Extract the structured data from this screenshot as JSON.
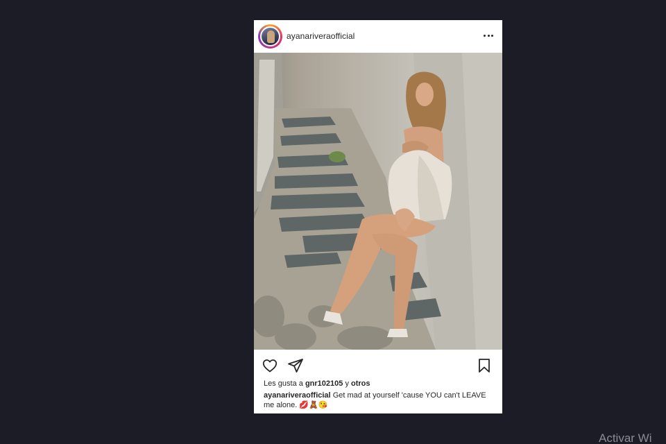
{
  "post": {
    "username": "ayanariveraofficial",
    "likes": {
      "prefix": "Les gusta a",
      "user": "gnr102105",
      "connector": "y",
      "others": "otros"
    },
    "caption": {
      "username": "ayanariveraofficial",
      "text": "Get mad at yourself 'cause YOU can't LEAVE me alone. 💋🧸😘"
    }
  },
  "icons": {
    "more": "more-options-icon",
    "like": "heart-icon",
    "share": "send-icon",
    "save": "bookmark-icon"
  },
  "watermark": "Activar Wi",
  "colors": {
    "background": "#1c1c26",
    "card": "#ffffff",
    "text": "#262626"
  }
}
